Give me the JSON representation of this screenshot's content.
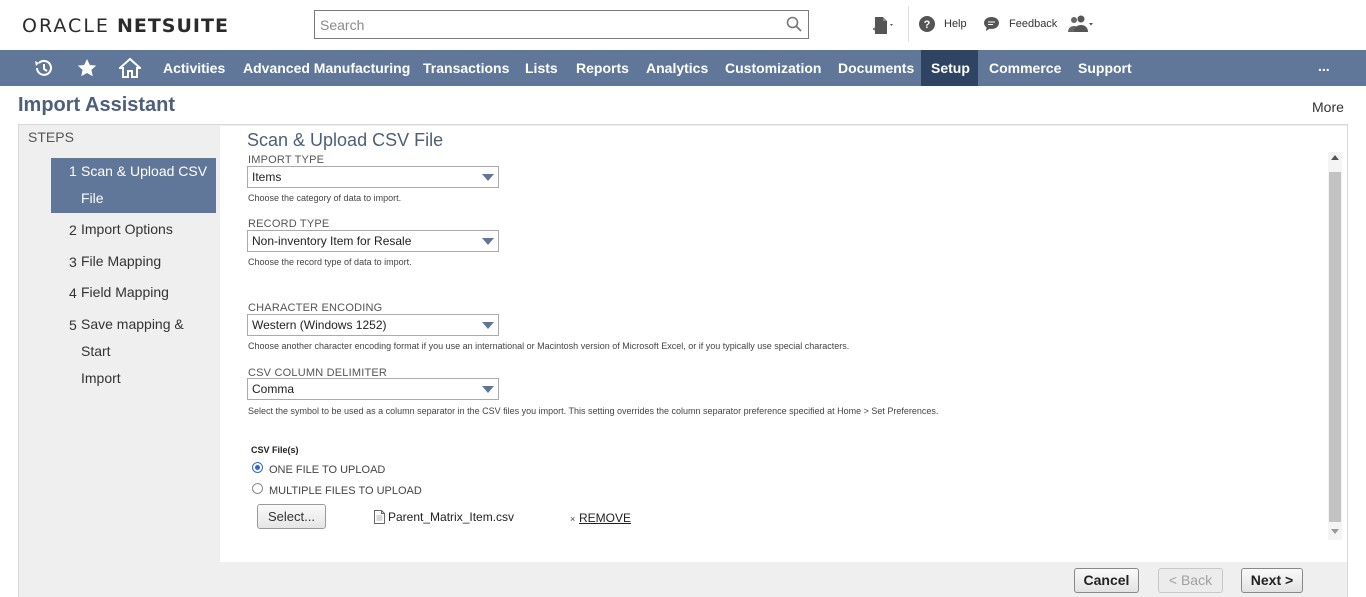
{
  "header": {
    "logo_oracle": "ORACLE",
    "logo_netsuite": "NETSUITE",
    "search_placeholder": "Search",
    "help_label": "Help",
    "feedback_label": "Feedback"
  },
  "nav": {
    "items": [
      "Activities",
      "Advanced Manufacturing",
      "Transactions",
      "Lists",
      "Reports",
      "Analytics",
      "Customization",
      "Documents",
      "Setup",
      "Commerce",
      "Support"
    ],
    "active": "Setup",
    "more": "..."
  },
  "page": {
    "title": "Import Assistant",
    "more_label": "More"
  },
  "steps": {
    "label": "STEPS",
    "items": [
      {
        "num": "1",
        "line1": "Scan & Upload CSV",
        "line2": "File"
      },
      {
        "num": "2",
        "line1": "Import Options",
        "line2": ""
      },
      {
        "num": "3",
        "line1": "File Mapping",
        "line2": ""
      },
      {
        "num": "4",
        "line1": "Field Mapping",
        "line2": ""
      },
      {
        "num": "5",
        "line1": "Save mapping & Start",
        "line2": "Import"
      }
    ]
  },
  "form": {
    "section_title": "Scan & Upload CSV File",
    "import_type": {
      "label": "IMPORT TYPE",
      "value": "Items",
      "help": "Choose the category of data to import."
    },
    "record_type": {
      "label": "RECORD TYPE",
      "value": "Non-inventory Item for Resale",
      "help": "Choose the record type of data to import."
    },
    "encoding": {
      "label": "CHARACTER ENCODING",
      "value": "Western (Windows 1252)",
      "help": "Choose another character encoding format if you use an international or Macintosh version of Microsoft Excel, or if you typically use special characters."
    },
    "delimiter": {
      "label": "CSV COLUMN DELIMITER",
      "value": "Comma",
      "help": "Select the symbol to be used as a column separator in the CSV files you import. This setting overrides the column separator preference specified at Home > Set Preferences."
    },
    "csv_files": {
      "label": "CSV File(s)",
      "one_file": "ONE FILE TO UPLOAD",
      "multiple_files": "MULTIPLE FILES TO UPLOAD",
      "selected": "one",
      "select_button": "Select...",
      "file_name": "Parent_Matrix_Item.csv",
      "remove_x": "×",
      "remove_label": "REMOVE"
    }
  },
  "actions": {
    "cancel": "Cancel",
    "back": "< Back",
    "next": "Next >"
  }
}
